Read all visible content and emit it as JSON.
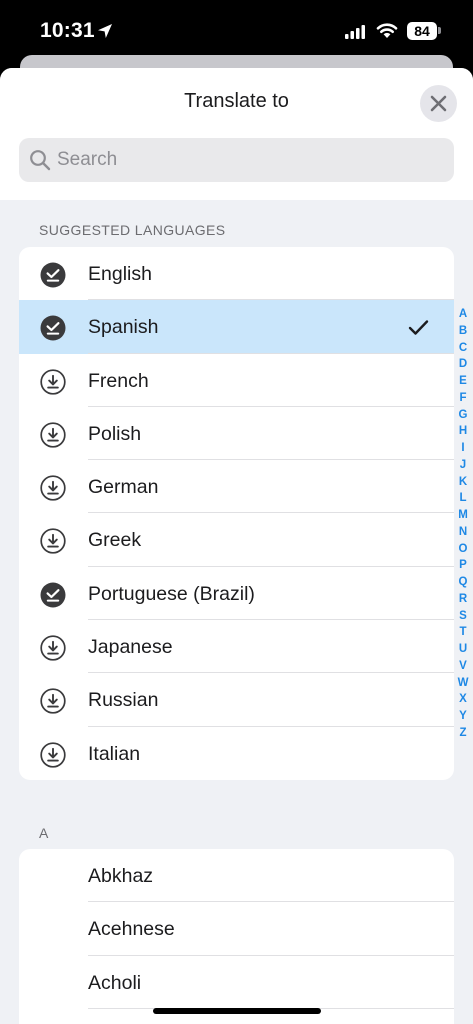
{
  "status_bar": {
    "time": "10:31",
    "battery": "84"
  },
  "header": {
    "title": "Translate to"
  },
  "search": {
    "placeholder": "Search"
  },
  "suggested": {
    "label": "SUGGESTED LANGUAGES",
    "items": [
      {
        "label": "English",
        "status": "downloaded",
        "selected": false
      },
      {
        "label": "Spanish",
        "status": "downloaded",
        "selected": true
      },
      {
        "label": "French",
        "status": "download",
        "selected": false
      },
      {
        "label": "Polish",
        "status": "download",
        "selected": false
      },
      {
        "label": "German",
        "status": "download",
        "selected": false
      },
      {
        "label": "Greek",
        "status": "download",
        "selected": false
      },
      {
        "label": "Portuguese (Brazil)",
        "status": "downloaded",
        "selected": false
      },
      {
        "label": "Japanese",
        "status": "download",
        "selected": false
      },
      {
        "label": "Russian",
        "status": "download",
        "selected": false
      },
      {
        "label": "Italian",
        "status": "download",
        "selected": false
      }
    ]
  },
  "section_a": {
    "label": "A",
    "items": [
      {
        "label": "Abkhaz"
      },
      {
        "label": "Acehnese"
      },
      {
        "label": "Acholi"
      }
    ]
  },
  "index_letters": [
    "A",
    "B",
    "C",
    "D",
    "E",
    "F",
    "G",
    "H",
    "I",
    "J",
    "K",
    "L",
    "M",
    "N",
    "O",
    "P",
    "Q",
    "R",
    "S",
    "T",
    "U",
    "V",
    "W",
    "X",
    "Y",
    "Z"
  ],
  "colors": {
    "accent": "#1e88e5",
    "selected_row": "#cae6fb",
    "background": "#eff1f5"
  }
}
